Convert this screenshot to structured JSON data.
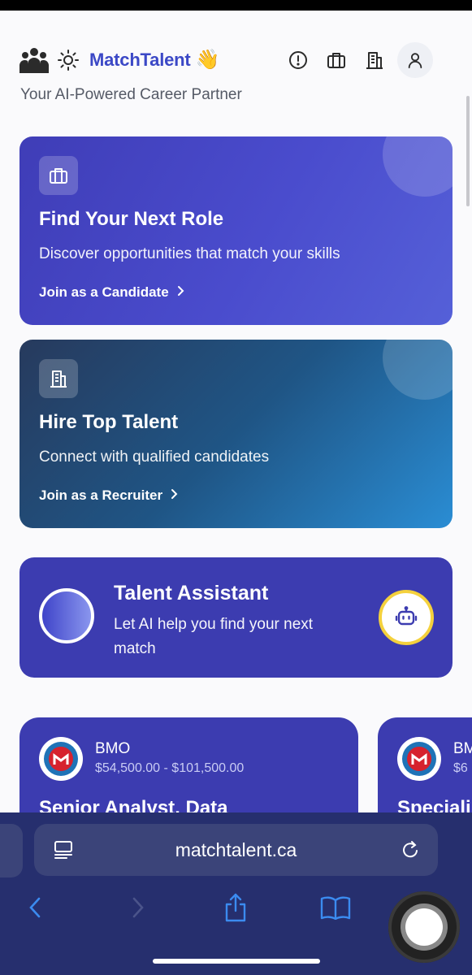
{
  "app": {
    "brand": "MatchTalent",
    "wave": "👋",
    "tagline": "Your AI-Powered Career Partner"
  },
  "header_icons": [
    "team-icon",
    "sun-icon",
    "info-icon",
    "briefcase-icon",
    "building-icon",
    "user-icon"
  ],
  "cards": {
    "candidate": {
      "title": "Find Your Next Role",
      "description": "Discover opportunities that match your skills",
      "link": "Join as a Candidate",
      "chevron": "›",
      "icon": "briefcase-icon"
    },
    "recruiter": {
      "title": "Hire Top Talent",
      "description": "Connect with qualified candidates",
      "link": "Join as a Recruiter",
      "chevron": "›",
      "icon": "building-icon"
    }
  },
  "assistant": {
    "title": "Talent Assistant",
    "description": "Let AI help you find your next match",
    "icon": "robot-icon"
  },
  "jobs": [
    {
      "company": "BMO",
      "salary": "$54,500.00 - $101,500.00",
      "title": "Senior Analyst, Data"
    },
    {
      "company": "BM",
      "salary": "$6",
      "title": "Speciali"
    }
  ],
  "browser": {
    "url": "matchtalent.ca"
  },
  "colors": {
    "brand": "#3b48c6",
    "card_primary": "#3c3cb0",
    "accent_yellow": "#f4d13d",
    "toolbar": "#262f6e",
    "bmo_red": "#d6222e"
  }
}
